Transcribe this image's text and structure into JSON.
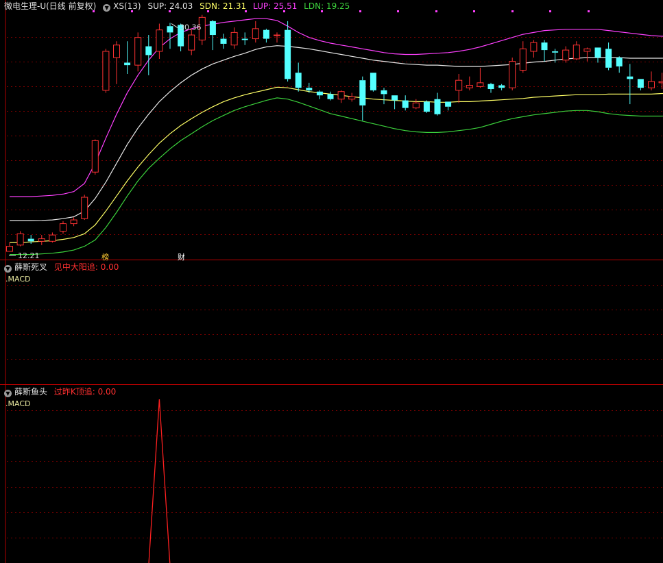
{
  "header": {
    "stock": "微电生理-U",
    "period": "(日线 前复权)",
    "indicator": "XS(13)",
    "sup": "SUP: 24.03",
    "sdn": "SDN: 21.31",
    "lup": "LUP: 25.51",
    "ldn": "LDN: 19.25"
  },
  "annotations": {
    "high_label": "30.36",
    "low_label": "12.21",
    "tag_rank": "榜",
    "tag_finance": "财"
  },
  "panel2": {
    "title": "薛斯死叉",
    "signal": "见中大阳追: 0.00",
    "sublabel": ".MACD"
  },
  "panel3": {
    "title": "薛斯鱼头",
    "signal": "过昨K顶追: 0.00",
    "sublabel": ".MACD"
  },
  "colors": {
    "up": "#ff3232",
    "down": "#54ffff",
    "sup": "#e8e8e8",
    "sdn": "#ffff66",
    "lup": "#ff40ff",
    "ldn": "#3cd23c",
    "grid": "#7a0000",
    "spike": "#ff2020"
  },
  "chart_data": [
    {
      "type": "candlestick",
      "title": "微电生理-U (日线 前复权)",
      "ylim": [
        11.6,
        31.2
      ],
      "candles": [
        [
          12.2,
          12.6,
          12.21,
          12.9
        ],
        [
          12.7,
          13.6,
          12.6,
          13.8
        ],
        [
          13.2,
          13.0,
          12.8,
          13.5
        ],
        [
          13.0,
          13.2,
          12.7,
          13.5
        ],
        [
          13.0,
          13.5,
          12.9,
          13.7
        ],
        [
          13.8,
          14.4,
          13.6,
          14.6
        ],
        [
          14.4,
          14.7,
          14.2,
          14.9
        ],
        [
          14.8,
          16.5,
          14.7,
          16.7
        ],
        [
          18.5,
          21.0,
          18.3,
          21.1
        ],
        [
          25.0,
          28.1,
          24.8,
          28.3
        ],
        [
          27.6,
          28.6,
          25.5,
          28.9
        ],
        [
          27.2,
          27.0,
          26.3,
          28.9
        ],
        [
          27.0,
          29.2,
          26.5,
          29.6
        ],
        [
          28.5,
          27.8,
          26.2,
          29.4
        ],
        [
          28.1,
          29.8,
          27.5,
          30.3
        ],
        [
          30.1,
          29.6,
          28.3,
          30.36
        ],
        [
          30.2,
          28.5,
          28.1,
          30.3
        ],
        [
          28.2,
          29.4,
          27.8,
          29.9
        ],
        [
          29.0,
          30.8,
          28.6,
          31.0
        ],
        [
          30.5,
          29.4,
          28.2,
          30.6
        ],
        [
          29.1,
          28.7,
          28.3,
          29.5
        ],
        [
          28.6,
          29.6,
          28.3,
          30.0
        ],
        [
          29.1,
          29.0,
          28.6,
          29.6
        ],
        [
          29.1,
          29.9,
          28.8,
          30.5
        ],
        [
          29.8,
          29.1,
          28.8,
          29.9
        ],
        [
          29.4,
          29.4,
          28.8,
          29.6
        ],
        [
          29.8,
          25.9,
          25.7,
          30.5
        ],
        [
          26.4,
          25.2,
          24.9,
          27.2
        ],
        [
          25.2,
          25.0,
          24.8,
          25.6
        ],
        [
          24.9,
          24.6,
          24.3,
          25.0
        ],
        [
          24.7,
          24.3,
          24.2,
          24.9
        ],
        [
          24.3,
          24.9,
          24.0,
          25.0
        ],
        [
          24.3,
          24.5,
          24.1,
          24.8
        ],
        [
          25.8,
          23.8,
          22.6,
          26.1
        ],
        [
          26.4,
          25.0,
          24.9,
          26.4
        ],
        [
          25.0,
          24.7,
          23.9,
          25.2
        ],
        [
          24.6,
          24.2,
          23.5,
          24.6
        ],
        [
          24.2,
          23.6,
          23.4,
          24.6
        ],
        [
          23.6,
          24.0,
          23.5,
          24.3
        ],
        [
          24.1,
          23.3,
          23.2,
          24.2
        ],
        [
          24.3,
          23.1,
          23.0,
          24.8
        ],
        [
          24.1,
          23.7,
          23.4,
          24.1
        ],
        [
          25.0,
          25.8,
          24.0,
          26.3
        ],
        [
          25.2,
          25.4,
          25.0,
          26.1
        ],
        [
          25.3,
          25.6,
          25.2,
          26.8
        ],
        [
          25.5,
          25.1,
          24.8,
          25.6
        ],
        [
          25.4,
          25.2,
          25.0,
          25.5
        ],
        [
          25.2,
          27.3,
          25.0,
          27.6
        ],
        [
          26.6,
          28.3,
          26.4,
          28.9
        ],
        [
          28.1,
          28.8,
          27.6,
          29.0
        ],
        [
          28.8,
          28.2,
          27.3,
          29.0
        ],
        [
          28.1,
          28.0,
          27.2,
          28.3
        ],
        [
          27.4,
          28.2,
          27.2,
          28.5
        ],
        [
          27.5,
          28.6,
          27.4,
          28.9
        ],
        [
          28.1,
          28.3,
          27.3,
          28.4
        ],
        [
          28.4,
          27.6,
          27.2,
          28.4
        ],
        [
          28.3,
          26.8,
          26.6,
          28.8
        ],
        [
          27.6,
          26.9,
          26.4,
          27.7
        ],
        [
          26.1,
          25.9,
          23.9,
          27.1
        ],
        [
          25.9,
          25.2,
          25.0,
          25.9
        ],
        [
          25.2,
          25.7,
          25.0,
          26.5
        ],
        [
          25.6,
          25.7,
          25.1,
          26.4
        ],
        [
          25.6,
          28.2,
          25.4,
          29.1
        ],
        [
          28.4,
          28.2,
          27.7,
          29.2
        ]
      ],
      "bands": {
        "SUP": [
          14.65,
          14.65,
          14.65,
          14.66,
          14.7,
          14.8,
          14.95,
          15.4,
          16.4,
          17.7,
          19.2,
          20.7,
          22.0,
          23.1,
          24.1,
          24.9,
          25.6,
          26.2,
          26.7,
          27.1,
          27.4,
          27.7,
          27.95,
          28.25,
          28.45,
          28.55,
          28.5,
          28.4,
          28.3,
          28.15,
          28.0,
          27.85,
          27.7,
          27.55,
          27.4,
          27.3,
          27.2,
          27.1,
          27.05,
          27.0,
          27.0,
          26.95,
          26.9,
          26.9,
          26.9,
          26.95,
          27.0,
          27.05,
          27.15,
          27.25,
          27.3,
          27.4,
          27.5,
          27.55,
          27.6,
          27.6,
          27.6,
          27.6,
          27.55,
          27.55,
          27.55,
          27.55,
          27.6,
          27.6
        ],
        "SDN": [
          12.9,
          12.9,
          12.95,
          13.0,
          13.05,
          13.15,
          13.3,
          13.6,
          14.3,
          15.4,
          16.6,
          17.8,
          18.9,
          19.9,
          20.8,
          21.55,
          22.2,
          22.75,
          23.25,
          23.7,
          24.1,
          24.4,
          24.65,
          24.85,
          25.05,
          25.25,
          25.2,
          25.05,
          24.9,
          24.8,
          24.7,
          24.6,
          24.5,
          24.4,
          24.3,
          24.25,
          24.2,
          24.15,
          24.1,
          24.1,
          24.05,
          24.05,
          24.1,
          24.1,
          24.15,
          24.2,
          24.25,
          24.3,
          24.35,
          24.45,
          24.5,
          24.55,
          24.6,
          24.65,
          24.65,
          24.65,
          24.7,
          24.7,
          24.7,
          24.7,
          24.7,
          24.75,
          24.75,
          24.8
        ],
        "LUP": [
          16.55,
          16.55,
          16.55,
          16.6,
          16.65,
          16.75,
          16.95,
          17.6,
          19.2,
          21.2,
          23.1,
          24.8,
          26.2,
          27.4,
          28.4,
          29.1,
          29.6,
          29.9,
          30.1,
          30.25,
          30.4,
          30.5,
          30.6,
          30.7,
          30.7,
          30.55,
          30.1,
          29.6,
          29.2,
          28.95,
          28.75,
          28.6,
          28.45,
          28.3,
          28.15,
          28.0,
          27.9,
          27.85,
          27.85,
          27.9,
          27.95,
          28.0,
          28.1,
          28.25,
          28.45,
          28.7,
          28.95,
          29.2,
          29.45,
          29.6,
          29.75,
          29.8,
          29.85,
          29.85,
          29.85,
          29.85,
          29.75,
          29.65,
          29.55,
          29.45,
          29.35,
          29.3,
          29.3,
          29.35
        ],
        "LDN": [
          11.95,
          11.95,
          11.95,
          12.0,
          12.05,
          12.15,
          12.3,
          12.6,
          13.1,
          14.1,
          15.3,
          16.6,
          17.8,
          18.8,
          19.6,
          20.35,
          21.0,
          21.55,
          22.1,
          22.6,
          23.0,
          23.4,
          23.7,
          23.95,
          24.2,
          24.4,
          24.3,
          24.05,
          23.75,
          23.45,
          23.15,
          22.95,
          22.75,
          22.55,
          22.35,
          22.15,
          21.95,
          21.8,
          21.7,
          21.65,
          21.65,
          21.7,
          21.8,
          21.9,
          22.05,
          22.3,
          22.55,
          22.75,
          22.9,
          23.05,
          23.15,
          23.25,
          23.35,
          23.4,
          23.4,
          23.3,
          23.15,
          23.05,
          23.0,
          22.95,
          22.95,
          22.95,
          23.0,
          23.0
        ]
      },
      "marker_high": {
        "index": 15,
        "value": 30.36
      },
      "marker_low": {
        "index": 0,
        "value": 12.21
      }
    },
    {
      "type": "line",
      "title": "薛斯死叉",
      "series": [
        {
          "name": "见中大阳追",
          "values": [
            0
          ]
        }
      ]
    },
    {
      "type": "line",
      "title": "薛斯鱼头",
      "series": [
        {
          "name": "过昨K顶追",
          "values": [
            0,
            0,
            0,
            0,
            0,
            0,
            0,
            0,
            0,
            0,
            0,
            0,
            0,
            0,
            1,
            0,
            0,
            0,
            0,
            0,
            0,
            0,
            0,
            0,
            0,
            0,
            0,
            0,
            0,
            0,
            0,
            0,
            0,
            0,
            0,
            0,
            0,
            0,
            0,
            0,
            0,
            0,
            0,
            0,
            0,
            0,
            0,
            0,
            0,
            0,
            0,
            0,
            0,
            0,
            0,
            0,
            0,
            0,
            0,
            0,
            0,
            0,
            0,
            0
          ]
        }
      ]
    }
  ]
}
